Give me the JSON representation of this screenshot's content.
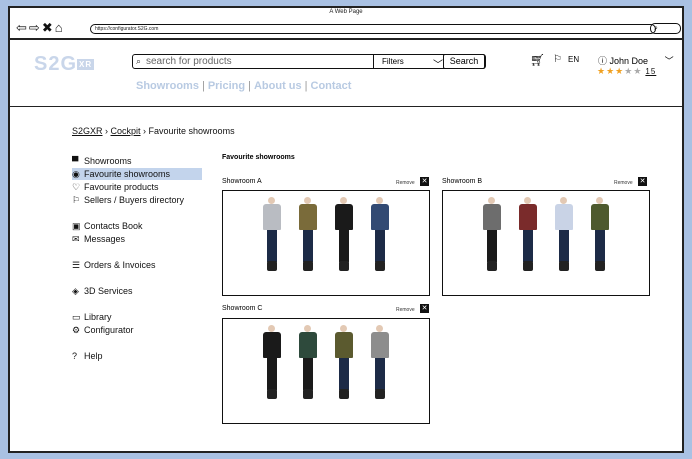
{
  "browser": {
    "title": "A Web Page",
    "url": "https://configurator.S2G.com"
  },
  "brand": {
    "logo": "S2G",
    "logo_badge": "XR"
  },
  "search": {
    "placeholder": "search for products",
    "filters_label": "Filters",
    "button": "Search"
  },
  "topnav": [
    "Showrooms",
    "Pricing",
    "About us",
    "Contact"
  ],
  "user": {
    "lang": "EN",
    "name": "John Doe",
    "rating_count": "15",
    "stars_filled": 3,
    "stars_total": 5
  },
  "breadcrumb": {
    "root": "S2GXR",
    "mid": "Cockpit",
    "current": "Favourite showrooms"
  },
  "sidebar": [
    {
      "label": "Showrooms",
      "icon": "store-icon"
    },
    {
      "label": "Favourite showrooms",
      "icon": "heart-circle-icon",
      "active": true
    },
    {
      "label": "Favourite products",
      "icon": "heart-outline-icon"
    },
    {
      "label": "Sellers / Buyers directory",
      "icon": "bookmark-icon"
    },
    {
      "label": "Contacts Book",
      "icon": "contact-card-icon"
    },
    {
      "label": "Messages",
      "icon": "mail-icon"
    },
    {
      "label": "Orders & Invoices",
      "icon": "invoice-icon"
    },
    {
      "label": "3D Services",
      "icon": "cube-icon"
    },
    {
      "label": "Library",
      "icon": "folder-icon"
    },
    {
      "label": "Configurator",
      "icon": "gear-icon"
    },
    {
      "label": "Help",
      "icon": "help-icon"
    }
  ],
  "content": {
    "title": "Favourite showrooms",
    "remove_label": "Remove"
  },
  "showrooms": [
    {
      "name": "Showroom A"
    },
    {
      "name": "Showroom B"
    },
    {
      "name": "Showroom C"
    }
  ],
  "colors": {
    "accent": "#c3d4ec",
    "nav": "#b8cae2",
    "logo": "#c9d6ea",
    "background": "#a9c1e3",
    "star": "#f0a020"
  }
}
